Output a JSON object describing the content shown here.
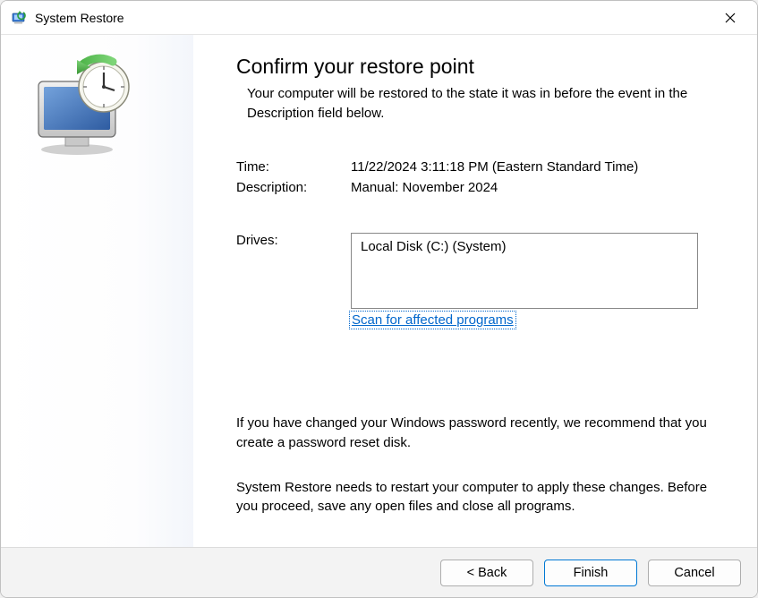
{
  "titlebar": {
    "title": "System Restore"
  },
  "main": {
    "heading": "Confirm your restore point",
    "subheading": "Your computer will be restored to the state it was in before the event in the Description field below.",
    "time_label": "Time:",
    "time_value": "11/22/2024 3:11:18 PM (Eastern Standard Time)",
    "description_label": "Description:",
    "description_value": "Manual: November 2024",
    "drives_label": "Drives:",
    "drives": [
      "Local Disk (C:) (System)"
    ],
    "scan_link": "Scan for affected programs",
    "password_note": "If you have changed your Windows password recently, we recommend that you create a password reset disk.",
    "restart_warning": "System Restore needs to restart your computer to apply these changes. Before you proceed, save any open files and close all programs."
  },
  "footer": {
    "back_label": "< Back",
    "finish_label": "Finish",
    "cancel_label": "Cancel"
  }
}
